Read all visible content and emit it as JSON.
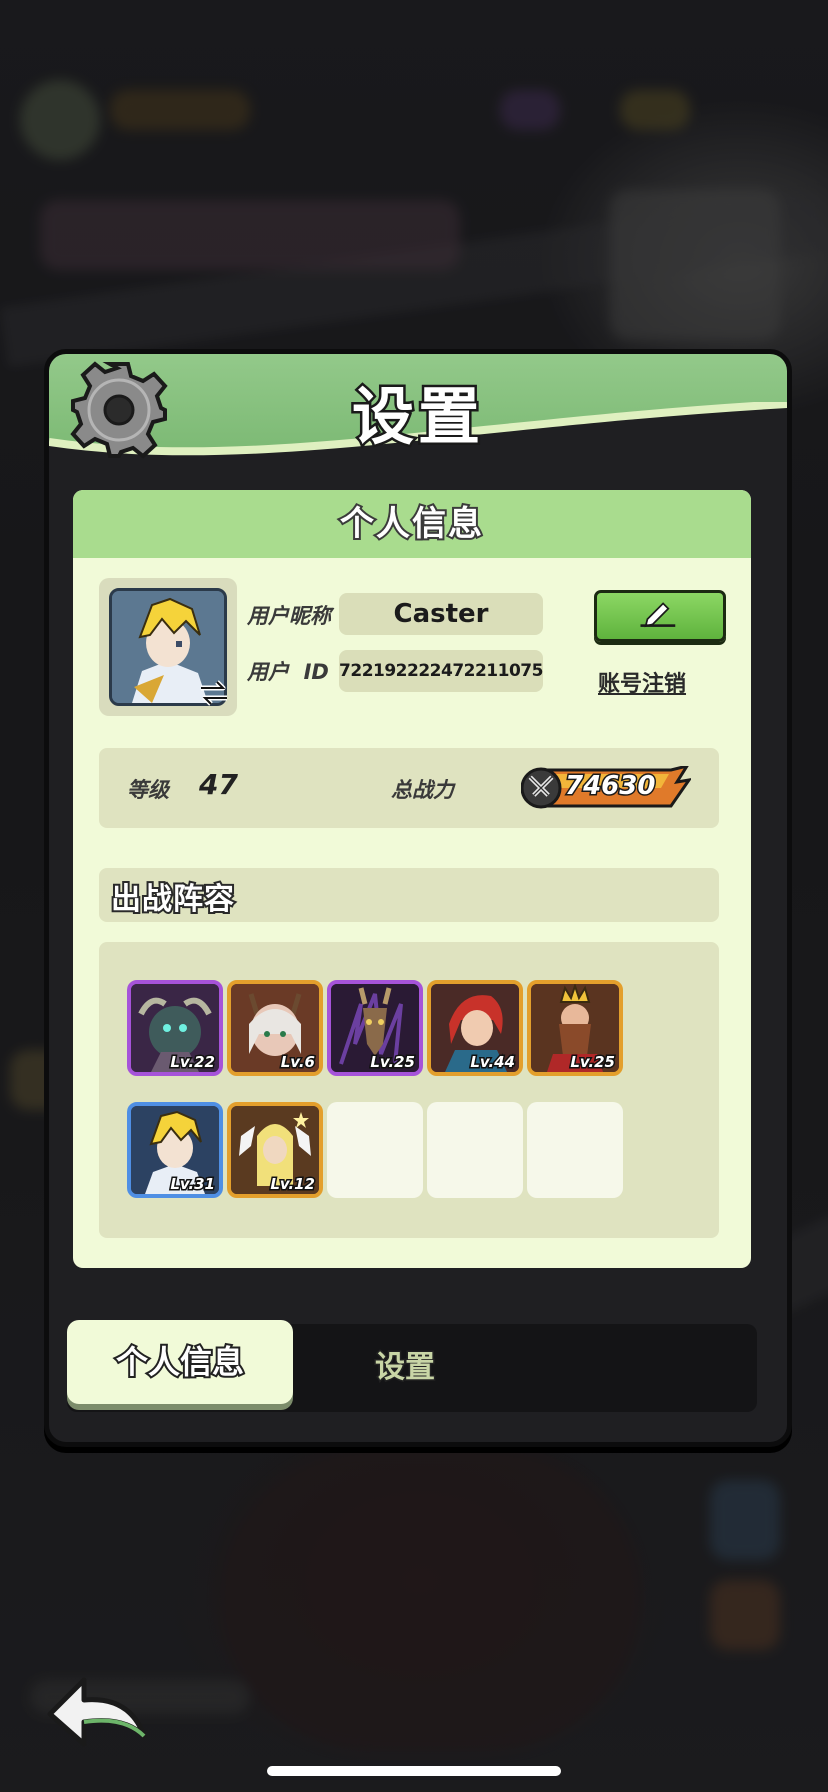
{
  "panel": {
    "title": "设置"
  },
  "profile": {
    "header": "个人信息",
    "nickname_label": "用户昵称",
    "nickname_value": "Caster",
    "id_label": "用户  ID",
    "id_value": "722192222472211075",
    "cancel_account_label": "账号注销",
    "level_label": "等级",
    "level_value": "47",
    "power_label": "总战力",
    "power_value": "74630"
  },
  "team": {
    "title": "出战阵容",
    "heroes": [
      {
        "level": "Lv.22",
        "rarity": "epic"
      },
      {
        "level": "Lv.6",
        "rarity": "legend"
      },
      {
        "level": "Lv.25",
        "rarity": "epic"
      },
      {
        "level": "Lv.44",
        "rarity": "legend"
      },
      {
        "level": "Lv.25",
        "rarity": "legend"
      },
      {
        "level": "Lv.31",
        "rarity": "rare"
      },
      {
        "level": "Lv.12",
        "rarity": "legend"
      }
    ]
  },
  "tabs": {
    "active": "个人信息",
    "inactive": "设置"
  },
  "colors": {
    "header_green": "#7ab872",
    "card_bg": "#f1fad8",
    "card_header": "#a9dc8e",
    "edit_button": "#6cc048",
    "epic_border": "#a653d9",
    "legend_border": "#e39f2c",
    "rare_border": "#4f8fe4"
  },
  "icons": [
    "gear-icon",
    "swap-icon",
    "pencil-icon",
    "sword-icon",
    "back-arrow-icon"
  ]
}
